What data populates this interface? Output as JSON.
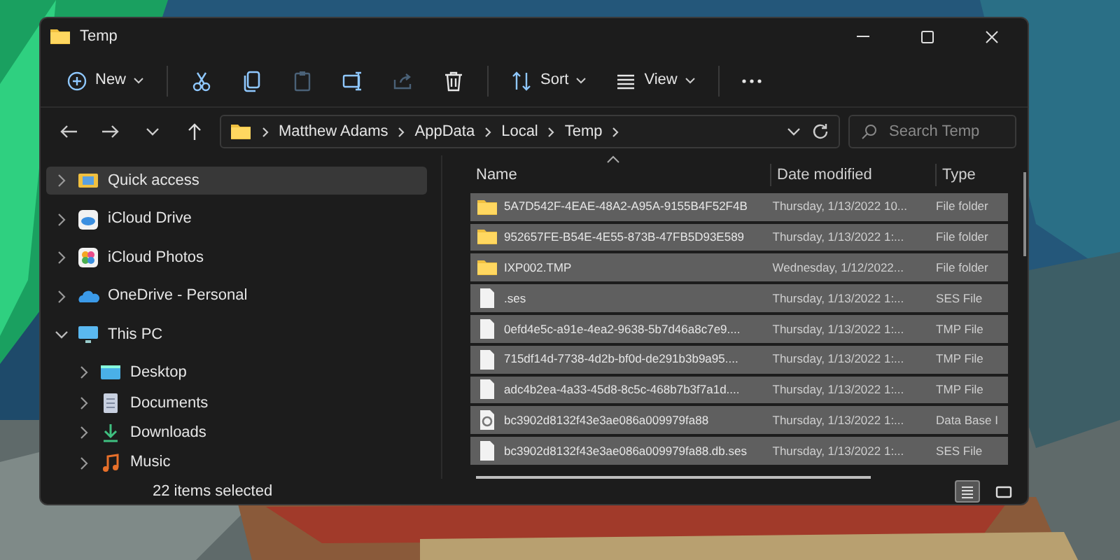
{
  "window": {
    "title": "Temp"
  },
  "toolbar": [
    {
      "kind": "new",
      "label": "New",
      "disabled": false
    },
    {
      "kind": "cut",
      "disabled": false
    },
    {
      "kind": "copy",
      "disabled": false
    },
    {
      "kind": "paste",
      "disabled": true
    },
    {
      "kind": "rename",
      "disabled": false
    },
    {
      "kind": "share",
      "disabled": true
    },
    {
      "kind": "delete",
      "disabled": false
    },
    {
      "kind": "sort",
      "label": "Sort",
      "disabled": false
    },
    {
      "kind": "view",
      "label": "View",
      "disabled": false
    },
    {
      "kind": "more",
      "disabled": false
    }
  ],
  "address": {
    "breadcrumbs": [
      "Matthew Adams",
      "AppData",
      "Local",
      "Temp"
    ]
  },
  "search": {
    "placeholder": "Search Temp"
  },
  "sidebar": {
    "items": [
      {
        "label": "Quick access",
        "kind": "star",
        "selected": true,
        "expanded": false
      },
      {
        "label": "iCloud Drive",
        "kind": "icloud",
        "selected": false,
        "expanded": false
      },
      {
        "label": "iCloud Photos",
        "kind": "photos",
        "selected": false,
        "expanded": false
      },
      {
        "label": "OneDrive - Personal",
        "kind": "onedrive",
        "selected": false,
        "expanded": false
      },
      {
        "label": "This PC",
        "kind": "pc",
        "selected": false,
        "expanded": true,
        "children": [
          {
            "label": "Desktop",
            "kind": "desktop",
            "selected": false,
            "expanded": false
          },
          {
            "label": "Documents",
            "kind": "documents",
            "selected": false,
            "expanded": false
          },
          {
            "label": "Downloads",
            "kind": "downloads",
            "selected": false,
            "expanded": false
          },
          {
            "label": "Music",
            "kind": "music",
            "selected": false,
            "expanded": false
          }
        ]
      }
    ]
  },
  "table": {
    "columns": [
      "Name",
      "Date modified",
      "Type"
    ],
    "rows": [
      {
        "kind": "folder",
        "name": "5A7D542F-4EAE-48A2-A95A-9155B4F52F4B",
        "date": "Thursday, 1/13/2022 10...",
        "type": "File folder",
        "selected": true
      },
      {
        "kind": "folder",
        "name": "952657FE-B54E-4E55-873B-47FB5D93E589",
        "date": "Thursday, 1/13/2022 1:...",
        "type": "File folder",
        "selected": true
      },
      {
        "kind": "folder",
        "name": "IXP002.TMP",
        "date": "Wednesday, 1/12/2022...",
        "type": "File folder",
        "selected": true
      },
      {
        "kind": "file",
        "name": ".ses",
        "date": "Thursday, 1/13/2022 1:...",
        "type": "SES File",
        "selected": true
      },
      {
        "kind": "file",
        "name": "0efd4e5c-a91e-4ea2-9638-5b7d46a8c7e9....",
        "date": "Thursday, 1/13/2022 1:...",
        "type": "TMP File",
        "selected": true
      },
      {
        "kind": "file",
        "name": "715df14d-7738-4d2b-bf0d-de291b3b9a95....",
        "date": "Thursday, 1/13/2022 1:...",
        "type": "TMP File",
        "selected": true
      },
      {
        "kind": "file",
        "name": "adc4b2ea-4a33-45d8-8c5c-468b7b3f7a1d....",
        "date": "Thursday, 1/13/2022 1:...",
        "type": "TMP File",
        "selected": true
      },
      {
        "kind": "database",
        "name": "bc3902d8132f43e3ae086a009979fa88",
        "date": "Thursday, 1/13/2022 1:...",
        "type": "Data Base I",
        "selected": true
      },
      {
        "kind": "file",
        "name": "bc3902d8132f43e3ae086a009979fa88.db.ses",
        "date": "Thursday, 1/13/2022 1:...",
        "type": "SES File",
        "selected": true
      }
    ]
  },
  "status_bar": {
    "text": "22 items selected"
  },
  "view_buttons": [
    {
      "kind": "details",
      "selected": true
    },
    {
      "kind": "tiles",
      "selected": false
    }
  ]
}
